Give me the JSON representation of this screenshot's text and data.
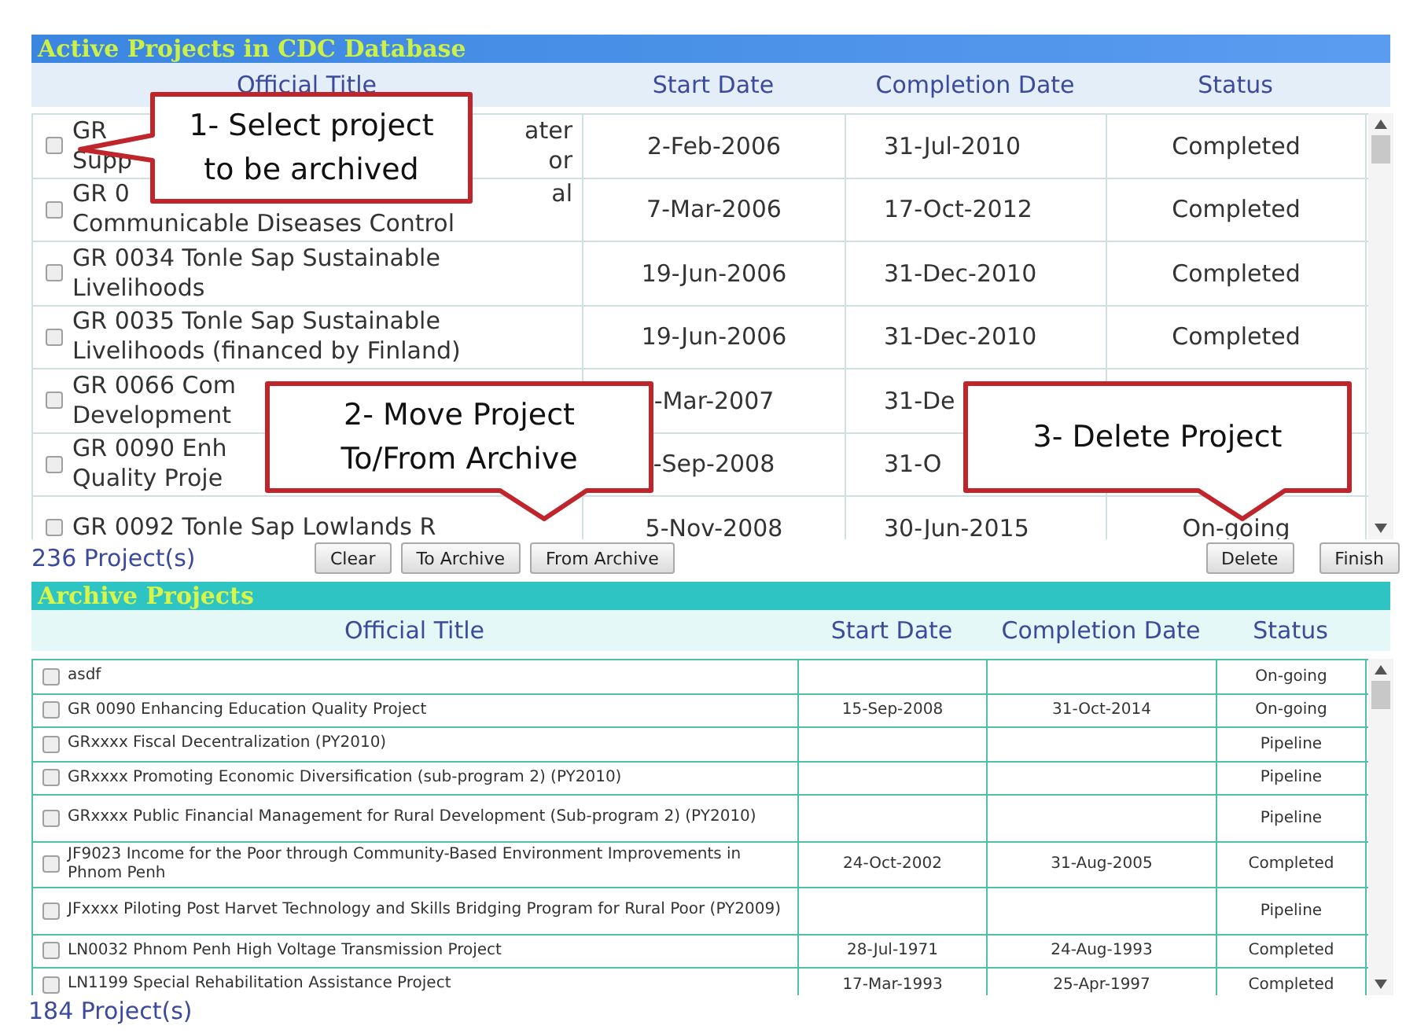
{
  "active_panel": {
    "title": "Active Projects in CDC Database",
    "columns": [
      "Official Title",
      "Start Date",
      "Completion Date",
      "Status"
    ],
    "rows": [
      {
        "checked": false,
        "title_lines": [
          [
            "GR",
            "ater"
          ],
          [
            "Supp",
            "or"
          ]
        ],
        "start_date": "2-Feb-2006",
        "completion_date": "31-Jul-2010",
        "status": "Completed"
      },
      {
        "checked": false,
        "title_lines": [
          [
            "GR 0",
            "al"
          ],
          [
            "Communicable Diseases Control"
          ]
        ],
        "start_date": "7-Mar-2006",
        "completion_date": "17-Oct-2012",
        "status": "Completed"
      },
      {
        "checked": false,
        "title_lines": [
          [
            "GR 0034 Tonle Sap Sustainable"
          ],
          [
            "Livelihoods"
          ]
        ],
        "start_date": "19-Jun-2006",
        "completion_date": "31-Dec-2010",
        "status": "Completed"
      },
      {
        "checked": false,
        "title_lines": [
          [
            "GR 0035 Tonle Sap Sustainable"
          ],
          [
            "Livelihoods (financed by Finland)"
          ]
        ],
        "start_date": "19-Jun-2006",
        "completion_date": "31-Dec-2010",
        "status": "Completed"
      },
      {
        "checked": false,
        "title_lines": [
          [
            "GR 0066 Com"
          ],
          [
            "Development"
          ]
        ],
        "start_date": "-Mar-2007",
        "completion_date": "31-De"
      },
      {
        "checked": false,
        "title_lines": [
          [
            "GR 0090 Enh"
          ],
          [
            "Quality Proje"
          ]
        ],
        "start_date": "-Sep-2008",
        "completion_date": "31-O"
      },
      {
        "checked": false,
        "title_lines": [
          [
            "GR 0092 Tonle Sap Lowlands R"
          ]
        ],
        "start_date": "5-Nov-2008",
        "completion_date": "30-Jun-2015",
        "status": "On-going"
      }
    ],
    "count": "236 Project(s)",
    "left_buttons": [
      "Clear",
      "To Archive",
      "From Archive"
    ],
    "right_buttons": [
      "Delete",
      "Finish"
    ]
  },
  "archive_panel": {
    "title": "Archive Projects",
    "columns": [
      "Official Title",
      "Start Date",
      "Completion Date",
      "Status"
    ],
    "rows": [
      {
        "checked": false,
        "title": "asdf",
        "status": "On-going"
      },
      {
        "checked": false,
        "title": "GR 0090 Enhancing Education Quality Project",
        "start_date": "15-Sep-2008",
        "completion_date": "31-Oct-2014",
        "status": "On-going"
      },
      {
        "checked": false,
        "title": "GRxxxx Fiscal Decentralization (PY2010)",
        "status": "Pipeline"
      },
      {
        "checked": false,
        "title": "GRxxxx Promoting Economic Diversification (sub-program 2) (PY2010)",
        "status": "Pipeline"
      },
      {
        "checked": false,
        "title": "GRxxxx Public Financial Management for Rural Development (Sub-program 2) (PY2010)",
        "status": "Pipeline"
      },
      {
        "checked": false,
        "title": "JF9023 Income for the Poor through Community-Based Environment Improvements in Phnom Penh",
        "start_date": "24-Oct-2002",
        "completion_date": "31-Aug-2005",
        "status": "Completed"
      },
      {
        "checked": false,
        "title": "JFxxxx Piloting Post Harvet Technology and Skills Bridging Program for Rural Poor (PY2009)",
        "status": "Pipeline"
      },
      {
        "checked": false,
        "title": "LN0032 Phnom Penh High Voltage Transmission Project",
        "start_date": "28-Jul-1971",
        "completion_date": "24-Aug-1993",
        "status": "Completed"
      },
      {
        "checked": false,
        "title": "LN1199 Special Rehabilitation Assistance Project",
        "start_date": "17-Mar-1993",
        "completion_date": "25-Apr-1997",
        "status": "Completed"
      }
    ],
    "count": "184 Project(s)"
  },
  "callouts": [
    {
      "text_lines": [
        "1- Select project",
        "to be archived"
      ]
    },
    {
      "text_lines": [
        "2- Move Project",
        "To/From Archive"
      ]
    },
    {
      "text_lines": [
        "3- Delete Project"
      ]
    }
  ]
}
